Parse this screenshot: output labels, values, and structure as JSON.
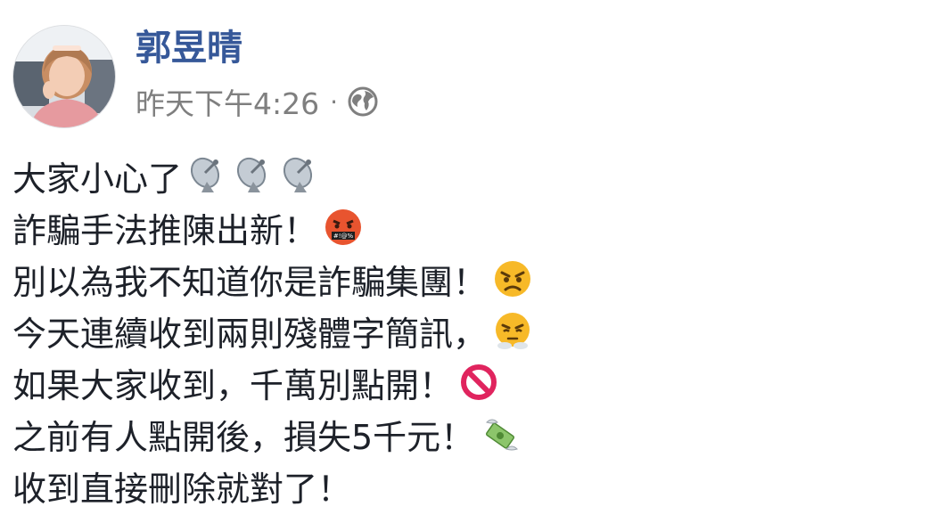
{
  "post": {
    "author": "郭昱晴",
    "timestamp": "昨天下午4:26",
    "separator": "·",
    "privacy_icon": "globe-icon",
    "lines": [
      {
        "text": "大家小心了",
        "emojis": [
          "satellite-dish-icon",
          "satellite-dish-icon",
          "satellite-dish-icon"
        ]
      },
      {
        "text": "詐騙手法推陳出新！",
        "emojis": [
          "cursing-face-icon"
        ]
      },
      {
        "text": "別以為我不知道你是詐騙集團！",
        "emojis": [
          "angry-face-icon"
        ]
      },
      {
        "text": "今天連續收到兩則殘體字簡訊，",
        "emojis": [
          "huffing-face-icon"
        ]
      },
      {
        "text": "如果大家收到，千萬別點開！",
        "emojis": [
          "prohibited-icon"
        ]
      },
      {
        "text": "之前有人點開後，損失5千元！",
        "emojis": [
          "money-with-wings-icon"
        ]
      },
      {
        "text": "收到直接刪除就對了！",
        "emojis": []
      }
    ]
  },
  "colors": {
    "author": "#365899",
    "meta": "#7f7f7f",
    "text": "#1d2129"
  }
}
